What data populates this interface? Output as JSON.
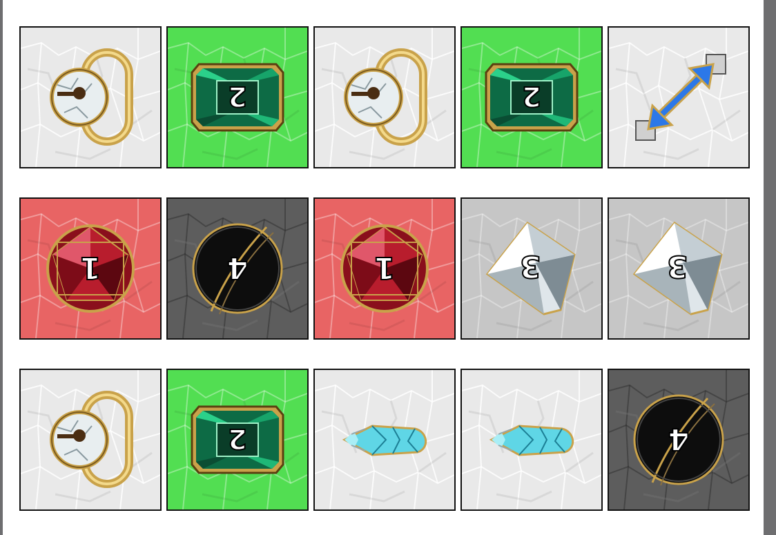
{
  "board": {
    "colors": {
      "white": "#e9e9e9",
      "green": "#52de52",
      "red": "#e86464",
      "dark": "#5d5d5d",
      "grey": "#c6c6c6",
      "border": "#111111"
    },
    "tiles": [
      {
        "color": "white",
        "icon": "padlock-icon"
      },
      {
        "color": "green",
        "icon": "emerald-gem-icon",
        "glyph": "2"
      },
      {
        "color": "white",
        "icon": "padlock-icon"
      },
      {
        "color": "green",
        "icon": "emerald-gem-icon",
        "glyph": "2"
      },
      {
        "color": "white",
        "icon": "diagonal-arrow-icon"
      },
      {
        "color": "red",
        "icon": "ruby-gem-icon",
        "glyph": "1"
      },
      {
        "color": "dark",
        "icon": "black-orb-icon",
        "glyph": "4"
      },
      {
        "color": "red",
        "icon": "ruby-gem-icon",
        "glyph": "1"
      },
      {
        "color": "grey",
        "icon": "diamond-gem-icon",
        "glyph": "3"
      },
      {
        "color": "grey",
        "icon": "diamond-gem-icon",
        "glyph": "3"
      },
      {
        "color": "white",
        "icon": "padlock-icon"
      },
      {
        "color": "green",
        "icon": "emerald-gem-icon",
        "glyph": "2"
      },
      {
        "color": "white",
        "icon": "crystal-shard-icon"
      },
      {
        "color": "white",
        "icon": "crystal-shard-icon"
      },
      {
        "color": "dark",
        "icon": "black-orb-icon",
        "glyph": "4"
      }
    ]
  }
}
